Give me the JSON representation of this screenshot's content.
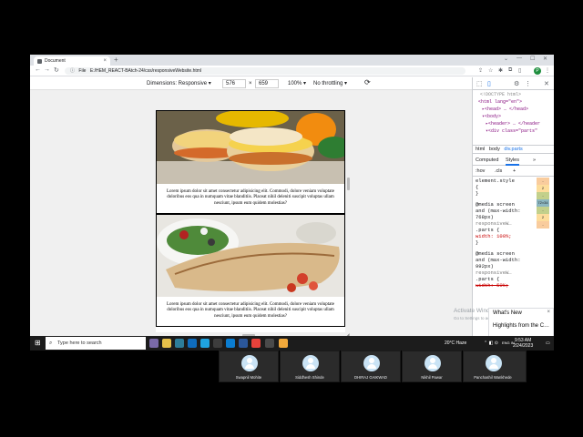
{
  "browser": {
    "tab_title": "Document",
    "tab_close": "×",
    "new_tab": "+",
    "window_controls": [
      "⌄",
      "—",
      "☐",
      "✕"
    ],
    "address": "E:/HEM_REACT-BAtch-24/css/responsiveWebsite.html",
    "file_label": "File",
    "nav": [
      "←",
      "→",
      "↻"
    ],
    "profile_initial": "P"
  },
  "device_toolbar": {
    "dimensions_label": "Dimensions: Responsive ▾",
    "width": "576",
    "x_sep": "×",
    "height": "659",
    "zoom": "100% ▾",
    "throttling": "No throttling ▾",
    "rotate_icon": "⟳"
  },
  "page": {
    "cards": [
      {
        "image": "sandwiches-photo",
        "caption": "Lorem ipsum dolor sit amet consectetur adipisicing elit. Commodi, dolore veniam voluptate doloribus eos qua in numquam vitae blanditiis. Placeat nihil deleniti suscipit voluptas ullam nesciunt, ipsum eum quidem molestias?"
      },
      {
        "image": "wrap-salad-photo",
        "caption": "Lorem ipsum dolor sit amet consectetur adipisicing elit. Commodi, dolore veniam voluptate doloribus eos qua in numquam vitae blanditiis. Placeat nihil deleniti suscipit voluptas ullam nesciunt, ipsum eum quidem molestias?"
      }
    ]
  },
  "devtools": {
    "dom_lines": [
      "<!DOCTYPE html>",
      "<html lang=\"en\">",
      "▸<head> … </head>",
      "▾<body>",
      "▸<header> … </header",
      "▾<div class=\"parts\""
    ],
    "breadcrumbs": [
      "html",
      "body",
      "div.parts"
    ],
    "subtabs": [
      "Computed",
      "Styles",
      "»"
    ],
    "filter": [
      ":hov",
      ".cls",
      "+"
    ],
    "styles_lines": [
      "element.style",
      "{",
      "}",
      "@media screen",
      "and (max-width:",
      "768px)",
      "  responsiveW…",
      ".parts {",
      "  width: 100%;",
      "}",
      "@media screen",
      "and (max-width:",
      "992px)",
      "  responsiveW…",
      ".parts {",
      "  width: 50%;"
    ],
    "box_values": [
      "-",
      "2",
      "-",
      "72×34",
      "-",
      "2",
      "-"
    ],
    "activate_text": [
      "Activate Windows",
      "Go to Settings to activate Windows."
    ]
  },
  "notification": {
    "title": "What's New",
    "close": "×",
    "subtitle": "Highlights from the C…"
  },
  "taskbar": {
    "search_placeholder": "Type here to search",
    "weather": "20°C  Haze",
    "lang": "ENG\nIN",
    "time": "9:53 AM",
    "date": "2/24/2023"
  },
  "meeting": {
    "participants": [
      "Swapnil Mohite",
      "Siddhesh Shinde",
      "DHIRAJ GAIKWAD",
      "Nikhil Pawar",
      "Panchashil Wankhede"
    ]
  },
  "colors": {
    "chrome_tab_strip": "#dee1e6",
    "selection_blue": "#1a73e8",
    "taskbar": "#1c1c1c"
  }
}
